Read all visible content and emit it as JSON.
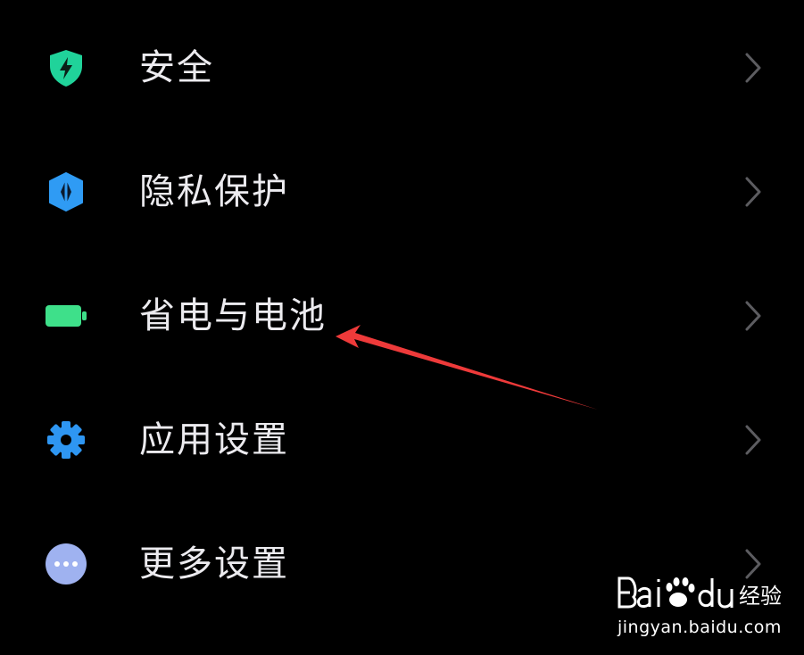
{
  "settings": {
    "items": [
      {
        "label": "安全",
        "icon": "shield-bolt-icon",
        "icon_color": "#20d39a"
      },
      {
        "label": "隐私保护",
        "icon": "privacy-shield-icon",
        "icon_color": "#2f9bf4"
      },
      {
        "label": "省电与电池",
        "icon": "battery-icon",
        "icon_color": "#3ee08a"
      },
      {
        "label": "应用设置",
        "icon": "gear-icon",
        "icon_color": "#2e96f2"
      },
      {
        "label": "更多设置",
        "icon": "more-dots-icon",
        "icon_color": "#9fb2f0"
      }
    ],
    "chevron_icon": "chevron-right-icon"
  },
  "annotation": {
    "type": "arrow",
    "color": "#ee3a3a",
    "points_to": "省电与电池"
  },
  "watermark": {
    "logo_text": "Bai du 经验",
    "url": "jingyan.baidu.com"
  },
  "colors": {
    "background": "#000000",
    "text": "#ecebef",
    "chevron": "#5c5c60"
  }
}
